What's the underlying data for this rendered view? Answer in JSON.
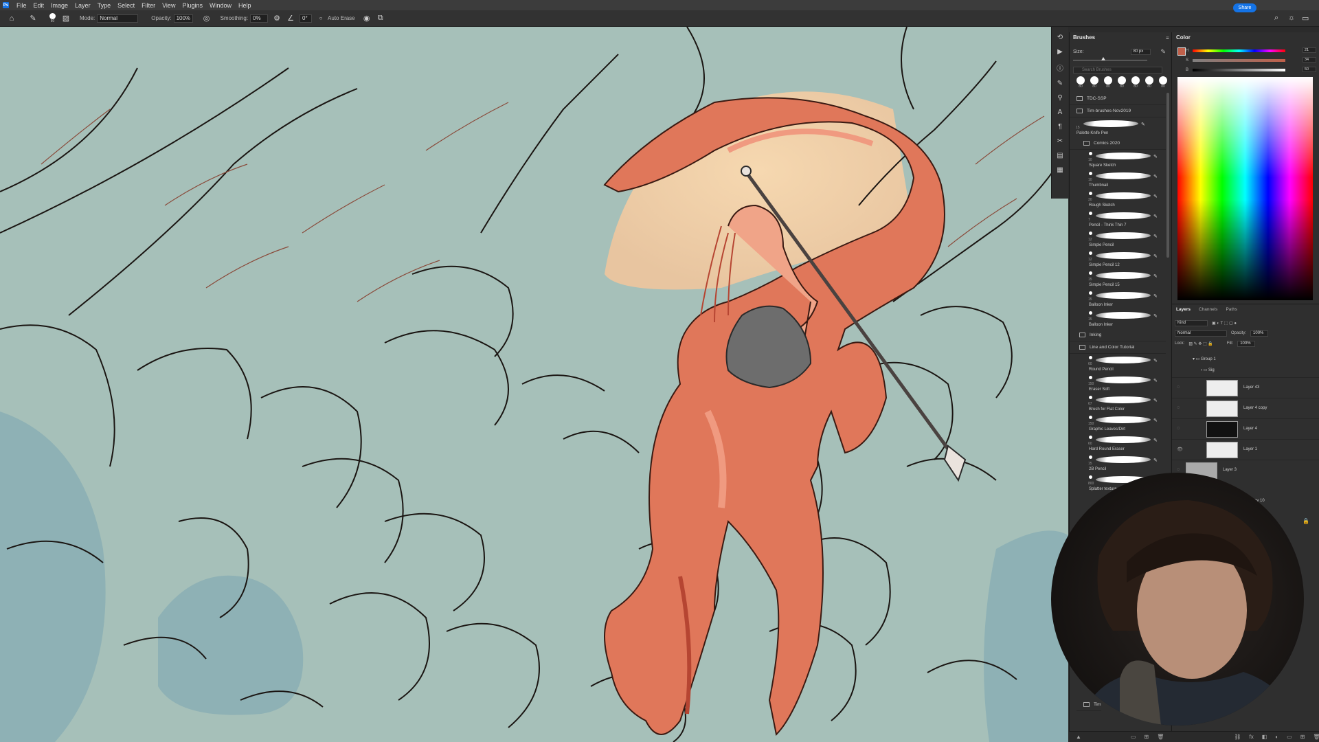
{
  "menubar": {
    "items": [
      "File",
      "Edit",
      "Image",
      "Layer",
      "Type",
      "Select",
      "Filter",
      "View",
      "Plugins",
      "Window",
      "Help"
    ]
  },
  "options_bar": {
    "brush_size": "80",
    "mode_label": "Mode:",
    "mode_value": "Normal",
    "opacity_label": "Opacity:",
    "opacity_value": "100%",
    "smoothing_label": "Smoothing:",
    "smoothing_value": "0%",
    "angle_value": "0°",
    "auto_erase_label": "Auto Erase",
    "share_label": "Share"
  },
  "brushes_panel": {
    "tab_label": "Brushes",
    "size_label": "Size:",
    "size_value": "80 px",
    "search_placeholder": "Search Brushes",
    "preset_sizes": [
      "80",
      "80",
      "80",
      "80",
      "80",
      "80",
      "80"
    ],
    "folders": {
      "tdc": "TDC-SSP",
      "tim": "Tim-brushes-Nov2019",
      "comics": "Comics 2020",
      "inking": "Inking",
      "line_color": "Line and Color Tutorial",
      "tim2": "Tim"
    },
    "brushes_top": [
      {
        "name": "Palette Knife Pen",
        "size": "15"
      }
    ],
    "brushes_comics": [
      {
        "name": "Square Sketch",
        "size": "10"
      },
      {
        "name": "Thumbnail",
        "size": "10"
      },
      {
        "name": "Rough Sketch",
        "size": "30"
      },
      {
        "name": "Pencil - Think Thin 7",
        "size": "7"
      },
      {
        "name": "Simple Pencil",
        "size": "12"
      },
      {
        "name": "Simple Pencil 12",
        "size": "12"
      },
      {
        "name": "Simple Pencil 15",
        "size": "15"
      },
      {
        "name": "Balloon Inker",
        "size": "15"
      },
      {
        "name": "Balloon Inker",
        "size": "15"
      }
    ],
    "brushes_tutorial": [
      {
        "name": "Round Pencil",
        "size": "60"
      },
      {
        "name": "Eraser Soft",
        "size": "150"
      },
      {
        "name": "Brush for Flat Color",
        "size": "67"
      },
      {
        "name": "Graphic Leaves/Dirt",
        "size": "150"
      },
      {
        "name": "Hard Round Eraser",
        "size": "60"
      },
      {
        "name": "2B Pencil",
        "size": "15"
      },
      {
        "name": "Splatter texture",
        "size": "800"
      }
    ]
  },
  "color_panel": {
    "tab_label": "Color",
    "h_label": "H",
    "h_value": "21",
    "s_label": "S",
    "s_value": "34",
    "b_label": "B",
    "b_value": "50",
    "fg_color": "#c0604a"
  },
  "layers_panel": {
    "tabs": [
      "Layers",
      "Channels",
      "Paths"
    ],
    "kind_label": "Kind",
    "blend_mode": "Normal",
    "opacity_label": "Opacity:",
    "opacity_value": "100%",
    "lock_label": "Lock:",
    "fill_label": "Fill:",
    "fill_value": "100%",
    "group1": "Group 1",
    "sig_group": "Sig",
    "layers": [
      "Layer 43",
      "Layer 4 copy",
      "Layer 4",
      "Layer 1",
      "Layer 3"
    ],
    "partial_layer": "ov 10"
  },
  "colors": {
    "canvas_bg": "#a6c0b9",
    "dragon": "#e0775a",
    "accent": "#1473e6"
  }
}
